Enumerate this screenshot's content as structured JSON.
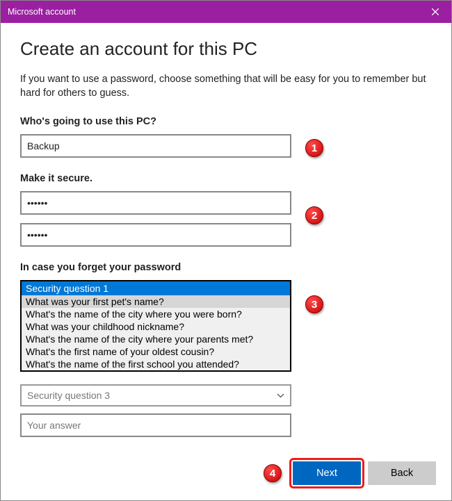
{
  "titlebar": {
    "title": "Microsoft account"
  },
  "page": {
    "title": "Create an account for this PC",
    "description": "If you want to use a password, choose something that will be easy for you to remember but hard for others to guess."
  },
  "sections": {
    "username_label": "Who's going to use this PC?",
    "username_value": "Backup",
    "password_label": "Make it secure.",
    "password1_value": "••••••",
    "password2_value": "••••••",
    "security_label": "In case you forget your password"
  },
  "dropdown_open": {
    "selected": "Security question 1",
    "hovered": "What was your first pet's name?",
    "options": [
      "What's the name of the city where you were born?",
      "What was your childhood nickname?",
      "What's the name of the city where your parents met?",
      "What's the first name of your oldest cousin?",
      "What's the name of the first school you attended?"
    ]
  },
  "select3": {
    "placeholder": "Security question 3"
  },
  "answer": {
    "placeholder": "Your answer"
  },
  "buttons": {
    "next": "Next",
    "back": "Back"
  },
  "callouts": {
    "c1": "1",
    "c2": "2",
    "c3": "3",
    "c4": "4"
  }
}
